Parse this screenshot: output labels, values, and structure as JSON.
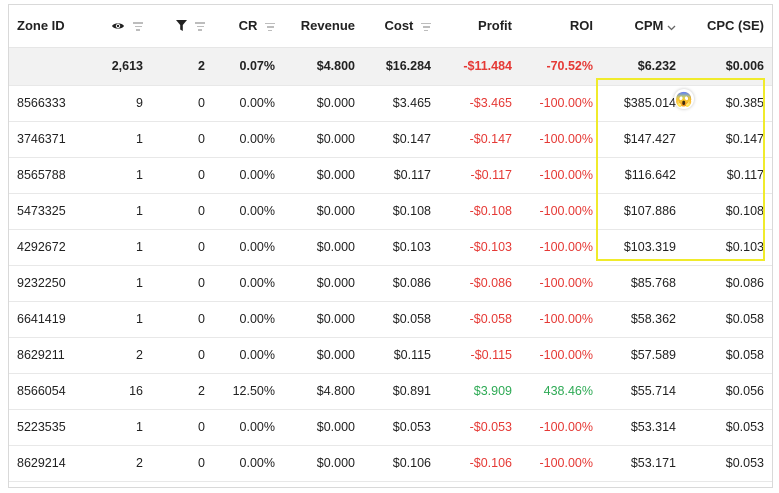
{
  "headers": {
    "zone_id": "Zone ID",
    "views_icon": "eye-icon",
    "conv_icon": "funnel-icon",
    "cr": "CR",
    "revenue": "Revenue",
    "cost": "Cost",
    "profit": "Profit",
    "roi": "ROI",
    "cpm": "CPM",
    "cpc": "CPC (SE)"
  },
  "sort": {
    "column": "cpm",
    "direction": "descending"
  },
  "summary": {
    "views": "2,613",
    "conversions": "2",
    "cr": "0.07%",
    "revenue": "$4.800",
    "cost": "$16.284",
    "profit": "-$11.484",
    "roi": "-70.52%",
    "cpm": "$6.232",
    "cpc": "$0.006"
  },
  "rows": [
    {
      "zone": "8566333",
      "views": "9",
      "conv": "0",
      "cr": "0.00%",
      "revenue": "$0.000",
      "cost": "$3.465",
      "profit": "-$3.465",
      "roi": "-100.00%",
      "cpm": "$385.014",
      "cpc": "$0.385",
      "status": "negative"
    },
    {
      "zone": "3746371",
      "views": "1",
      "conv": "0",
      "cr": "0.00%",
      "revenue": "$0.000",
      "cost": "$0.147",
      "profit": "-$0.147",
      "roi": "-100.00%",
      "cpm": "$147.427",
      "cpc": "$0.147",
      "status": "negative"
    },
    {
      "zone": "8565788",
      "views": "1",
      "conv": "0",
      "cr": "0.00%",
      "revenue": "$0.000",
      "cost": "$0.117",
      "profit": "-$0.117",
      "roi": "-100.00%",
      "cpm": "$116.642",
      "cpc": "$0.117",
      "status": "negative"
    },
    {
      "zone": "5473325",
      "views": "1",
      "conv": "0",
      "cr": "0.00%",
      "revenue": "$0.000",
      "cost": "$0.108",
      "profit": "-$0.108",
      "roi": "-100.00%",
      "cpm": "$107.886",
      "cpc": "$0.108",
      "status": "negative"
    },
    {
      "zone": "4292672",
      "views": "1",
      "conv": "0",
      "cr": "0.00%",
      "revenue": "$0.000",
      "cost": "$0.103",
      "profit": "-$0.103",
      "roi": "-100.00%",
      "cpm": "$103.319",
      "cpc": "$0.103",
      "status": "negative"
    },
    {
      "zone": "9232250",
      "views": "1",
      "conv": "0",
      "cr": "0.00%",
      "revenue": "$0.000",
      "cost": "$0.086",
      "profit": "-$0.086",
      "roi": "-100.00%",
      "cpm": "$85.768",
      "cpc": "$0.086",
      "status": "negative"
    },
    {
      "zone": "6641419",
      "views": "1",
      "conv": "0",
      "cr": "0.00%",
      "revenue": "$0.000",
      "cost": "$0.058",
      "profit": "-$0.058",
      "roi": "-100.00%",
      "cpm": "$58.362",
      "cpc": "$0.058",
      "status": "negative"
    },
    {
      "zone": "8629211",
      "views": "2",
      "conv": "0",
      "cr": "0.00%",
      "revenue": "$0.000",
      "cost": "$0.115",
      "profit": "-$0.115",
      "roi": "-100.00%",
      "cpm": "$57.589",
      "cpc": "$0.058",
      "status": "negative"
    },
    {
      "zone": "8566054",
      "views": "16",
      "conv": "2",
      "cr": "12.50%",
      "revenue": "$4.800",
      "cost": "$0.891",
      "profit": "$3.909",
      "roi": "438.46%",
      "cpm": "$55.714",
      "cpc": "$0.056",
      "status": "positive"
    },
    {
      "zone": "5223535",
      "views": "1",
      "conv": "0",
      "cr": "0.00%",
      "revenue": "$0.000",
      "cost": "$0.053",
      "profit": "-$0.053",
      "roi": "-100.00%",
      "cpm": "$53.314",
      "cpc": "$0.053",
      "status": "negative"
    },
    {
      "zone": "8629214",
      "views": "2",
      "conv": "0",
      "cr": "0.00%",
      "revenue": "$0.000",
      "cost": "$0.106",
      "profit": "-$0.106",
      "roi": "-100.00%",
      "cpm": "$53.171",
      "cpc": "$0.053",
      "status": "negative"
    }
  ],
  "emoji": {
    "name": "screaming-face-icon",
    "glyph": "😱"
  },
  "colors": {
    "negative": "#e53935",
    "positive": "#2eaa55",
    "highlight": "#f0eb2b",
    "summary_bg": "#f2f2f2"
  }
}
